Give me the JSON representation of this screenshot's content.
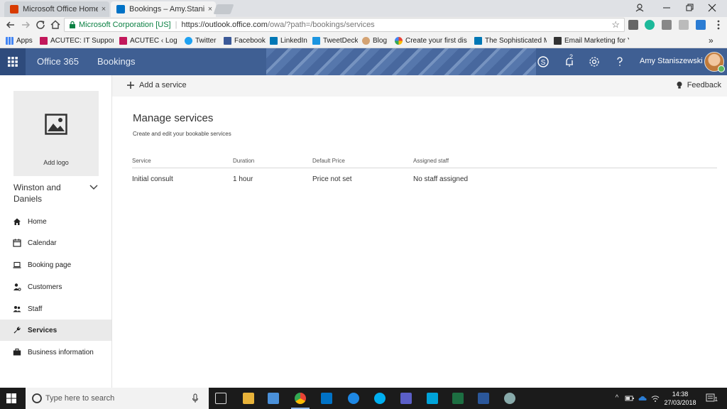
{
  "browser": {
    "tabs": [
      {
        "label": "Microsoft Office Home",
        "icon": "office-icon"
      },
      {
        "label": "Bookings – Amy.Stanisze",
        "icon": "outlook-icon"
      }
    ],
    "close_glyph": "×",
    "address": {
      "secure_label": "Microsoft Corporation [US]",
      "url_host": "https://outlook.office.com",
      "url_path": "/owa/?path=/bookings/services"
    },
    "bookmarks": [
      "Apps",
      "ACUTEC: IT Support, T",
      "ACUTEC ‹ Log In",
      "Twitter",
      "Facebook",
      "LinkedIn",
      "TweetDeck",
      "Blog",
      "Create your first disp",
      "The Sophisticated Ma",
      "Email Marketing for Y"
    ],
    "more_bookmarks": "»"
  },
  "header": {
    "product": "Office 365",
    "app": "Bookings",
    "notifications_count": "2",
    "user_name": "Amy Staniszewski"
  },
  "sidebar": {
    "logo_label": "Add logo",
    "business_name_line1": "Winston and",
    "business_name_line2": "Daniels",
    "items": [
      {
        "label": "Home",
        "icon": "home-icon"
      },
      {
        "label": "Calendar",
        "icon": "calendar-icon"
      },
      {
        "label": "Booking page",
        "icon": "laptop-icon"
      },
      {
        "label": "Customers",
        "icon": "customers-icon"
      },
      {
        "label": "Staff",
        "icon": "staff-icon"
      },
      {
        "label": "Services",
        "icon": "wrench-icon"
      },
      {
        "label": "Business information",
        "icon": "briefcase-icon"
      }
    ],
    "active_item": "Services"
  },
  "commandbar": {
    "add_label": "Add a service",
    "feedback_label": "Feedback"
  },
  "main": {
    "title": "Manage services",
    "subtitle": "Create and edit your bookable services",
    "columns": [
      "Service",
      "Duration",
      "Default Price",
      "Assigned staff"
    ],
    "rows": [
      [
        "Initial consult",
        "1 hour",
        "Price not set",
        "No staff assigned"
      ]
    ]
  },
  "taskbar": {
    "search_placeholder": "Type here to search",
    "time": "14:38",
    "date": "27/03/2018",
    "notification_count": "1"
  },
  "colors": {
    "office_header": "#3f5f93",
    "accent": "#0078d7",
    "taskbar": "#1b1b1b"
  }
}
